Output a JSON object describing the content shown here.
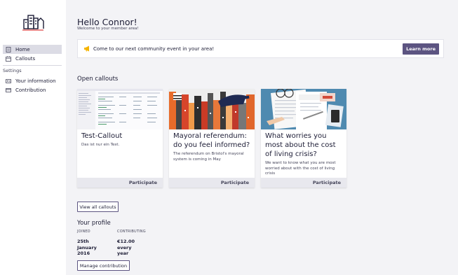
{
  "sidebar": {
    "items": [
      {
        "label": "Home",
        "icon": "home-icon",
        "active": true
      },
      {
        "label": "Callouts",
        "icon": "calendar-icon",
        "active": false
      }
    ],
    "settings_label": "Settings",
    "settings_items": [
      {
        "label": "Your information",
        "icon": "id-card-icon"
      },
      {
        "label": "Contribution",
        "icon": "credit-card-icon"
      }
    ]
  },
  "header": {
    "greeting": "Hello Connor!",
    "welcome": "Welcome to your member area!"
  },
  "notice": {
    "icon": "megaphone-icon",
    "text": "Come to our next community event in your area!",
    "button": "Learn more"
  },
  "callouts": {
    "title": "Open callouts",
    "items": [
      {
        "title": "Test-Callout",
        "description": "Das ist nur ein Test.",
        "action": "Participate"
      },
      {
        "title": "Mayoral referendum: do you feel informed?",
        "description": "The referendum on Bristol's mayoral system is coming in May",
        "action": "Participate"
      },
      {
        "title": "What worries you most about the cost of living crisis?",
        "description": "We want to know what you are most worried about with the cost of living crisis",
        "action": "Participate"
      }
    ],
    "view_all": "View all callouts"
  },
  "profile": {
    "title": "Your profile",
    "joined_label": "JOINED",
    "joined_value": "25th January 2016",
    "contributing_label": "CONTRIBUTING",
    "contributing_value": "€12.00 every year",
    "manage_button": "Manage contribution"
  },
  "colors": {
    "accent": "#5c5481",
    "background": "#f3f3f6",
    "megaphone": "#f5b400"
  }
}
